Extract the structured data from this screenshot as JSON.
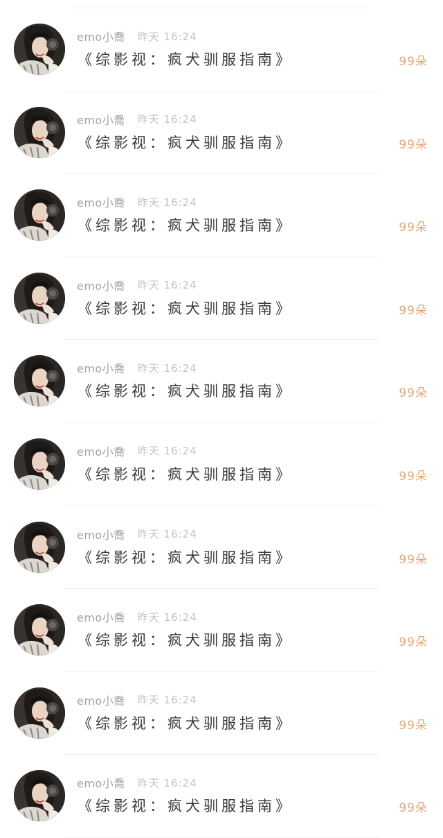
{
  "feed": {
    "items": [
      {
        "username": "emo小喬",
        "time": "昨天 16:24",
        "title": "《综影视：疯犬驯服指南》",
        "count": "99朵"
      },
      {
        "username": "emo小喬",
        "time": "昨天 16:24",
        "title": "《综影视：疯犬驯服指南》",
        "count": "99朵"
      },
      {
        "username": "emo小喬",
        "time": "昨天 16:24",
        "title": "《综影视：疯犬驯服指南》",
        "count": "99朵"
      },
      {
        "username": "emo小喬",
        "time": "昨天 16:24",
        "title": "《综影视：疯犬驯服指南》",
        "count": "99朵"
      },
      {
        "username": "emo小喬",
        "time": "昨天 16:24",
        "title": "《综影视：疯犬驯服指南》",
        "count": "99朵"
      },
      {
        "username": "emo小喬",
        "time": "昨天 16:24",
        "title": "《综影视：疯犬驯服指南》",
        "count": "99朵"
      },
      {
        "username": "emo小喬",
        "time": "昨天 16:24",
        "title": "《综影视：疯犬驯服指南》",
        "count": "99朵"
      },
      {
        "username": "emo小喬",
        "time": "昨天 16:24",
        "title": "《综影视：疯犬驯服指南》",
        "count": "99朵"
      },
      {
        "username": "emo小喬",
        "time": "昨天 16:24",
        "title": "《综影视：疯犬驯服指南》",
        "count": "99朵"
      },
      {
        "username": "emo小喬",
        "time": "昨天 16:24",
        "title": "《综影视：疯犬驯服指南》",
        "count": "99朵"
      }
    ]
  },
  "colors": {
    "username": "#a3a3a3",
    "time": "#c2c2c2",
    "title": "#3a3a3a",
    "count_accent": "#e6a678"
  }
}
